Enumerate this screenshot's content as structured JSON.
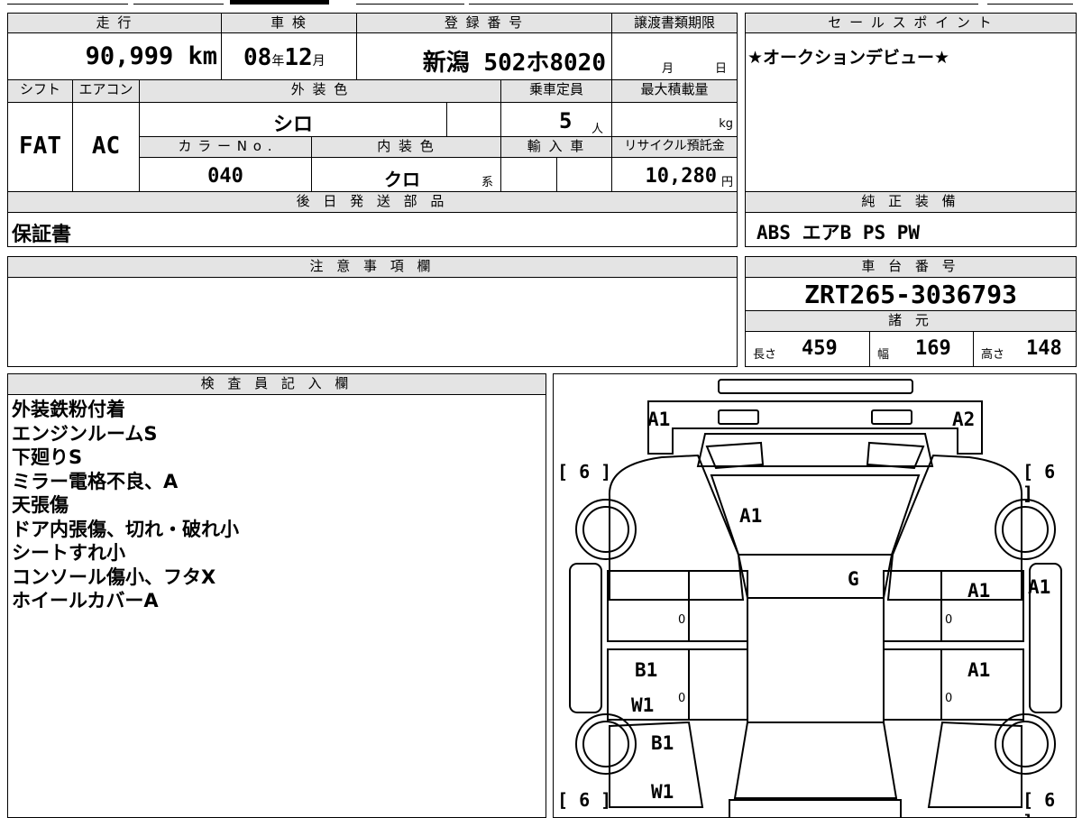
{
  "labels": {
    "mileage": "走 行",
    "inspection": "車 検",
    "registration": "登 録 番 号",
    "transfer_deadline": "譲渡書類期限",
    "shift": "シフト",
    "aircon": "エアコン",
    "exterior_color": "外 装 色",
    "capacity": "乗車定員",
    "max_load": "最大積載量",
    "color_no": "カ ラ ー N o .",
    "interior_color": "内 装 色",
    "import": "輸 入 車",
    "recycle": "リサイクル預託金",
    "later_parts": "後 日 発 送 部 品",
    "sales_point": "セ ー ル ス ポ イ ン ト",
    "standard_equipment": "純 正 装 備",
    "notes": "注 意 事 項 欄",
    "chassis_no": "車 台 番 号",
    "specs": "諸 元",
    "inspector": "検 査 員 記 入 欄"
  },
  "values": {
    "mileage": "90,999",
    "mileage_unit": "km",
    "inspection_year": "08",
    "year_unit": "年",
    "inspection_month": "12",
    "month_unit": "月",
    "registration": "新潟 502ホ8020",
    "deadline_month": "月",
    "deadline_day": "日",
    "shift": "FAT",
    "aircon": "AC",
    "exterior_color": "シロ",
    "capacity": "5",
    "capacity_unit": "人",
    "load_unit": "kg",
    "color_no": "040",
    "interior_color": "クロ",
    "interior_suffix": "系",
    "recycle": "10,280",
    "recycle_unit": "円",
    "later_parts": "保証書",
    "sales_point": "★オークションデビュー★",
    "standard_equipment": "ABS エアB PS PW",
    "chassis_no": "ZRT265-3036793",
    "length_label": "長さ",
    "length": "459",
    "width_label": "幅",
    "width": "169",
    "height_label": "高さ",
    "height": "148"
  },
  "inspector_notes": [
    "外装鉄粉付着",
    "エンジンルームS",
    "下廻りS",
    "ミラー電格不良、A",
    "天張傷",
    "ドア内張傷、切れ・破れ小",
    "シートすれ小",
    "コンソール傷小、フタX",
    "ホイールカバーA"
  ],
  "diagram": {
    "marks": {
      "front_left": "A1",
      "front_right": "A2",
      "windshield": "A1",
      "glass": "G",
      "front_door_right": "A1",
      "fender_right": "A1",
      "rear_door_right": "A1",
      "rear_door_left_1": "B1",
      "rear_door_left_2": "W1",
      "rear_fender_left_1": "B1",
      "rear_fender_left_2": "W1"
    },
    "tire_tl": "[ 6 ]",
    "tire_tr": "[ 6 ]",
    "tire_bl": "[ 6 ]",
    "tire_br": "[ 6 ]",
    "zero": "0"
  }
}
